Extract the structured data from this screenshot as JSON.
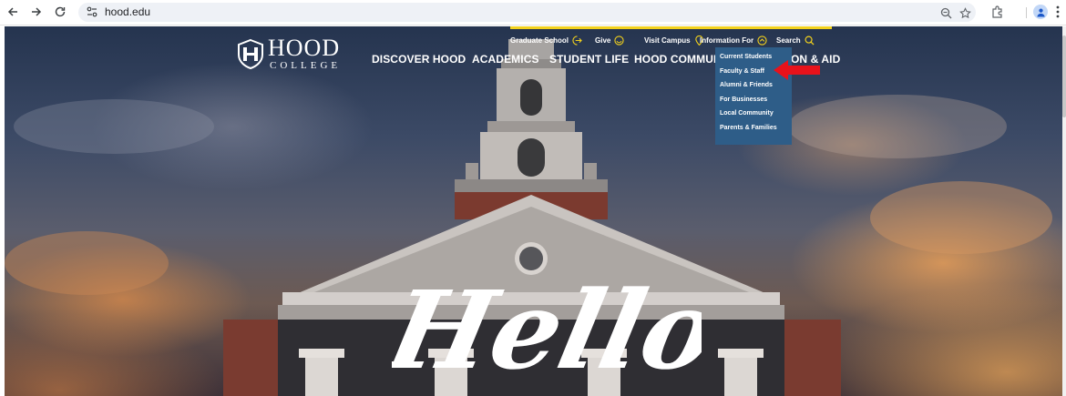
{
  "browser": {
    "url": "hood.edu",
    "icons": {
      "back": "back-arrow-icon",
      "forward": "forward-arrow-icon",
      "reload": "reload-icon",
      "site_info": "tune-icon",
      "zoom": "zoom-icon",
      "bookmark": "star-icon",
      "extensions": "puzzle-icon",
      "profile": "profile-icon",
      "menu": "more-vert-icon"
    }
  },
  "site": {
    "logo": {
      "name_top": "HOOD",
      "name_bottom": "COLLEGE"
    },
    "utility_nav": [
      {
        "label": "Graduate School",
        "icon": "arrow-right-circle-icon"
      },
      {
        "label": "Give",
        "icon": "smile-circle-icon"
      },
      {
        "label": "Visit Campus",
        "icon": "map-pin-icon"
      },
      {
        "label": "Information For",
        "icon": "chevron-up-circle-icon"
      },
      {
        "label": "Search",
        "icon": "search-icon"
      }
    ],
    "main_nav": [
      {
        "label": "DISCOVER HOOD"
      },
      {
        "label": "ACADEMICS"
      },
      {
        "label": "STUDENT LIFE"
      },
      {
        "label": "HOOD COMMUNI"
      },
      {
        "label": "ON & AID"
      }
    ],
    "info_for_menu": [
      {
        "label": "Current Students"
      },
      {
        "label": "Faculty & Staff"
      },
      {
        "label": "Alumni & Friends"
      },
      {
        "label": "For Businesses"
      },
      {
        "label": "Local Community"
      },
      {
        "label": "Parents & Families"
      }
    ],
    "hero_text": "Hello"
  },
  "colors": {
    "accent_yellow": "#f2d11d",
    "dropdown_blue": "#2e5d88",
    "annotation_red": "#e8121b"
  }
}
